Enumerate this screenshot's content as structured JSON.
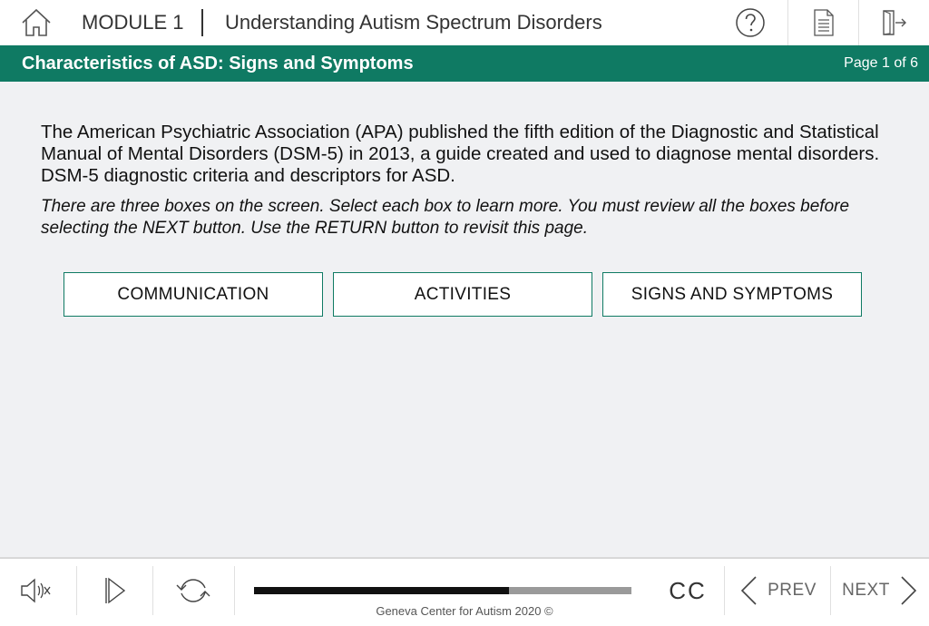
{
  "header": {
    "module_label": "MODULE 1",
    "course_title": "Understanding Autism Spectrum Disorders",
    "icons": [
      "home-icon",
      "help-icon",
      "document-icon",
      "exit-icon"
    ]
  },
  "section": {
    "title": "Characteristics of ASD: Signs and Symptoms",
    "page_counter": "Page 1 of 6",
    "color": "#0f7a63"
  },
  "content": {
    "intro": "The American Psychiatric Association (APA) published the fifth edition of the Diagnostic and Statistical Manual of Mental Disorders (DSM-5) in 2013, a guide created and used to diagnose mental disorders. DSM-5 diagnostic criteria and descriptors for ASD.",
    "instructions": "There are three boxes on the screen. Select each box to learn more. You must review all the boxes before selecting the NEXT button. Use the RETURN button to revisit this page."
  },
  "boxes": [
    {
      "label": "COMMUNICATION"
    },
    {
      "label": "ACTIVITIES"
    },
    {
      "label": "SIGNS AND SYMPTOMS"
    }
  ],
  "footer": {
    "icons": [
      "volume-icon",
      "play-icon",
      "replay-icon"
    ],
    "progress_fraction": 0.676,
    "cc_label": "CC",
    "prev_label": "PREV",
    "next_label": "NEXT",
    "copyright": "Geneva Center for Autism 2020 ©"
  }
}
